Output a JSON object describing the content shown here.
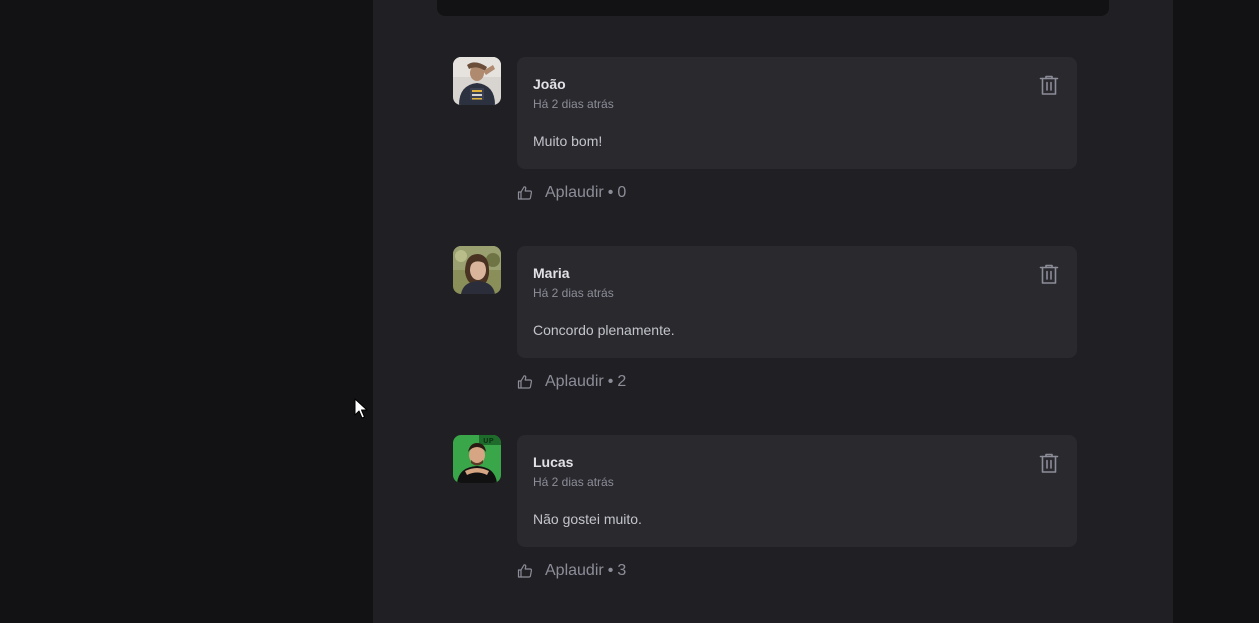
{
  "comments": [
    {
      "author": "João",
      "time": "Há 2 dias atrás",
      "content": "Muito bom!",
      "applaud_label": "Aplaudir",
      "applaud_separator": "•",
      "applaud_count": "0",
      "avatar_colors": {
        "bg": "#d8d4cf",
        "shirt": "#2c3140",
        "skin": "#b08a6e"
      }
    },
    {
      "author": "Maria",
      "time": "Há 2 dias atrás",
      "content": "Concordo plenamente.",
      "applaud_label": "Aplaudir",
      "applaud_separator": "•",
      "applaud_count": "2",
      "avatar_colors": {
        "bg": "#8a8f5a",
        "hair": "#4a3222",
        "skin": "#d9b59c"
      }
    },
    {
      "author": "Lucas",
      "time": "Há 2 dias atrás",
      "content": "Não gostei muito.",
      "applaud_label": "Aplaudir",
      "applaud_separator": "•",
      "applaud_count": "3",
      "avatar_colors": {
        "bg": "#3aa64a",
        "shirt": "#111111",
        "skin": "#d6a584"
      }
    }
  ],
  "icons": {
    "delete": "trash-icon",
    "applaud": "thumbs-up-icon",
    "cursor": "mouse-pointer-icon"
  },
  "colors": {
    "page_bg": "#121214",
    "card_bg": "#202024",
    "comment_bg": "#29292e",
    "text_primary": "#e1e1e6",
    "text_secondary": "#8d8d99",
    "text_body": "#c4c4cc"
  }
}
